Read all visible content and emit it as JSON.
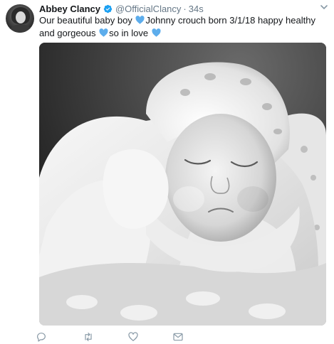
{
  "tweet": {
    "author_name": "Abbey Clancy",
    "handle": "@OfficialClancy",
    "separator": "·",
    "time": "34s",
    "text_part1": "Our beautiful baby boy",
    "text_part2": "Johnny crouch born 3/1/18 happy healthy and gorgeous",
    "text_part3": "so in love"
  },
  "icons": {
    "avatar": "profile-avatar",
    "verified": "verified-badge-icon",
    "more": "chevron-down-icon",
    "emoji": "blue-heart-icon",
    "reply": "reply-icon",
    "retweet": "retweet-icon",
    "like": "like-icon",
    "message": "direct-message-icon"
  },
  "colors": {
    "accent": "#1da1f2",
    "text": "#14171a",
    "muted": "#657786",
    "heart": "#5dadec"
  }
}
